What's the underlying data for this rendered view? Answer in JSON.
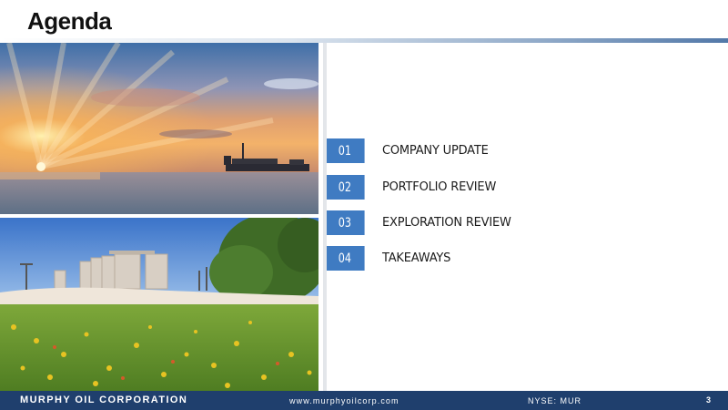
{
  "slide": {
    "title": "Agenda",
    "page_number": "3"
  },
  "agenda": {
    "items": [
      {
        "number": "01",
        "label": "COMPANY UPDATE"
      },
      {
        "number": "02",
        "label": "PORTFOLIO REVIEW"
      },
      {
        "number": "03",
        "label": "EXPLORATION REVIEW"
      },
      {
        "number": "04",
        "label": "TAKEAWAYS"
      }
    ]
  },
  "images": {
    "top": "offshore-platform-sunset-photo",
    "bottom": "oilfield-storage-tanks-wildflowers-photo"
  },
  "footer": {
    "company": "MURPHY OIL CORPORATION",
    "url": "www.murphyoilcorp.com",
    "ticker": "NYSE: MUR"
  },
  "colors": {
    "accent_blue": "#3f7bc2",
    "footer_navy": "#1f3f6d",
    "title_text": "#111111"
  }
}
